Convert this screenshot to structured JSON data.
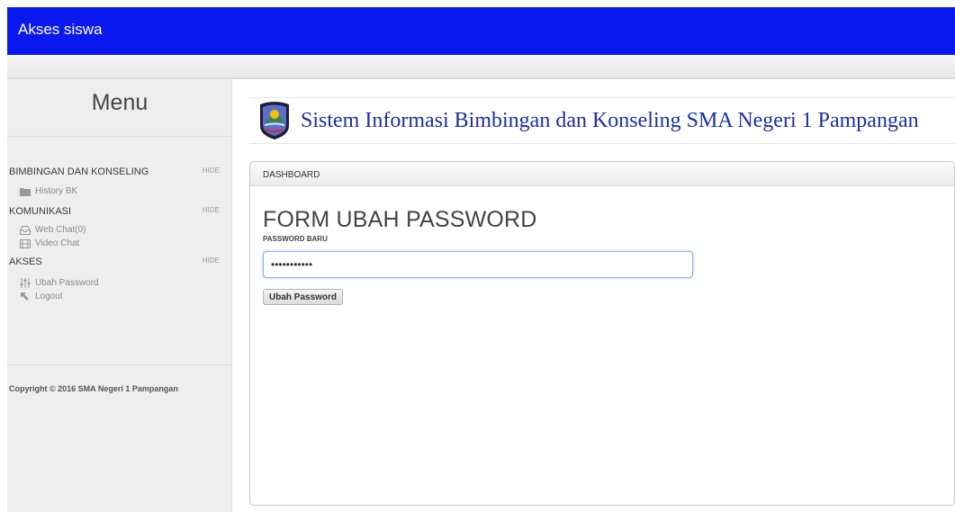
{
  "app": {
    "title": "Akses siswa"
  },
  "sidebar": {
    "menu_title": "Menu",
    "sections": [
      {
        "name": "BIMBINGAN DAN KONSELING",
        "hide_label": "HIDE",
        "items": [
          {
            "label": "History BK",
            "icon": "folder-icon"
          }
        ]
      },
      {
        "name": "KOMUNIKASI",
        "hide_label": "HIDE",
        "items": [
          {
            "label": "Web Chat(0)",
            "icon": "inbox-icon"
          },
          {
            "label": "Video Chat",
            "icon": "film-icon"
          }
        ]
      },
      {
        "name": "AKSES",
        "hide_label": "HIDE",
        "items": [
          {
            "label": "Ubah Password",
            "icon": "sliders-icon"
          },
          {
            "label": "Logout",
            "icon": "arrow-up-left-icon"
          }
        ]
      }
    ],
    "copyright": "Copyright © 2016 SMA Negeri 1 Pampangan"
  },
  "banner": {
    "title": "Sistem Informasi Bimbingan dan Konseling SMA Negeri 1 Pampangan"
  },
  "panel": {
    "heading": "DASHBOARD",
    "form_title": "FORM UBAH PASSWORD",
    "field_label": "PASSWORD BARU",
    "password_value": "•••••••••••",
    "submit_label": "Ubah Password"
  },
  "colors": {
    "topbar": "#0a18f0",
    "banner_text": "#1a2fa8"
  }
}
